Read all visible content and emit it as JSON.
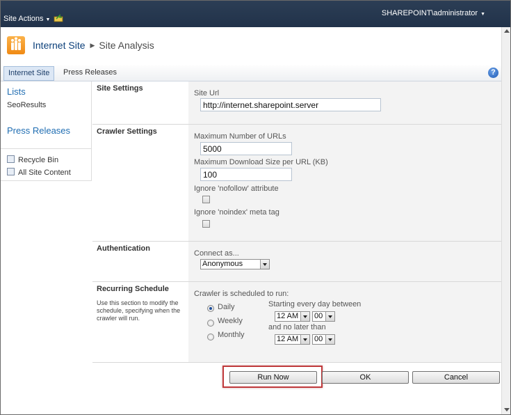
{
  "topbar": {
    "site_actions": "Site Actions",
    "user": "SHAREPOINT\\administrator"
  },
  "breadcrumb": {
    "site": "Internet Site",
    "page": "Site Analysis"
  },
  "topnav": {
    "tabs": [
      {
        "label": "Internet Site",
        "selected": true
      },
      {
        "label": "Press Releases",
        "selected": false
      }
    ],
    "help_glyph": "?"
  },
  "leftnav": {
    "lists_heading": "Lists",
    "lists_items": [
      "SeoResults"
    ],
    "press_heading": "Press Releases",
    "utility_items": [
      "Recycle Bin",
      "All Site Content"
    ]
  },
  "sections": {
    "site_settings": {
      "title": "Site Settings",
      "url_label": "Site Url",
      "url_value": "http://internet.sharepoint.server"
    },
    "crawler_settings": {
      "title": "Crawler Settings",
      "max_urls_label": "Maximum Number of URLs",
      "max_urls_value": "5000",
      "max_download_label": "Maximum Download Size per URL (KB)",
      "max_download_value": "100",
      "nofollow_label": "Ignore 'nofollow' attribute",
      "nofollow_checked": false,
      "noindex_label": "Ignore 'noindex' meta tag",
      "noindex_checked": false
    },
    "authentication": {
      "title": "Authentication",
      "connect_label": "Connect as...",
      "connect_value": "Anonymous"
    },
    "recurring_schedule": {
      "title": "Recurring Schedule",
      "description": "Use this section to modify the schedule, specifying when the crawler will run.",
      "scheduled_label": "Crawler is scheduled to run:",
      "options": [
        "Daily",
        "Weekly",
        "Monthly"
      ],
      "selected_option": "Daily",
      "start_label": "Starting every day between",
      "start_hour": "12 AM",
      "start_minute": "00",
      "end_label": "and no later than",
      "end_hour": "12 AM",
      "end_minute": "00"
    }
  },
  "buttons": {
    "run_now": "Run Now",
    "ok": "OK",
    "cancel": "Cancel"
  },
  "colors": {
    "topbar": "#21324a",
    "link": "#1f6db2",
    "highlight": "#c0393b",
    "logo": "#f08a14"
  }
}
